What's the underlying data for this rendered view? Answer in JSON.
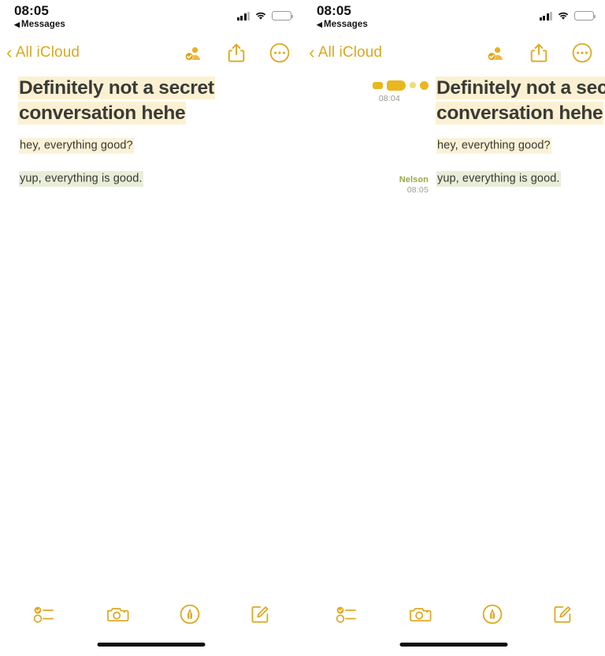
{
  "meta": {
    "app": "Apple Notes",
    "view": "note-detail-collaboration-comparison",
    "accent_color": "#d9a821",
    "highlight_cream": "#faf2d8",
    "highlight_green": "#e9eeda",
    "author_color": "#9aa846",
    "text_color": "#38382f",
    "title_color": "#3a3a36"
  },
  "status_bar": {
    "time": "08:05",
    "back_label": "Messages",
    "back_arrow": "◀",
    "icons": {
      "cellular": "signal-bars-icon",
      "wifi": "wifi-icon",
      "battery": "battery-low-power-icon"
    }
  },
  "nav_bar": {
    "back_label": "All iCloud",
    "back_chevron": "‹",
    "actions": [
      {
        "name": "collaborate-icon",
        "label": "Collaborate"
      },
      {
        "name": "share-icon",
        "label": "Share"
      },
      {
        "name": "more-options-icon",
        "label": "More"
      }
    ]
  },
  "note": {
    "title_line_1": "Definitely not a secret",
    "title_line_2": "conversation hehe",
    "paragraphs": [
      {
        "text": "hey, everything good?",
        "highlight": "cream"
      },
      {
        "text": "yup, everything is good.",
        "highlight": "green"
      }
    ]
  },
  "collaboration": {
    "change_markers": {
      "timestamp": "08:04",
      "blobs": [
        "blob-small",
        "blob-wide",
        "blob-dot",
        "blob-round"
      ]
    },
    "author_annotation": {
      "name": "Nelson",
      "timestamp": "08:05"
    }
  },
  "toolbar": {
    "items": [
      {
        "name": "checklist-icon",
        "label": "Checklist"
      },
      {
        "name": "camera-icon",
        "label": "Camera"
      },
      {
        "name": "markup-pen-icon",
        "label": "Markup"
      },
      {
        "name": "compose-icon",
        "label": "New Note"
      }
    ]
  },
  "panels": [
    {
      "id": "left",
      "variant": "plain-note"
    },
    {
      "id": "right",
      "variant": "with-collaboration-markers"
    }
  ]
}
